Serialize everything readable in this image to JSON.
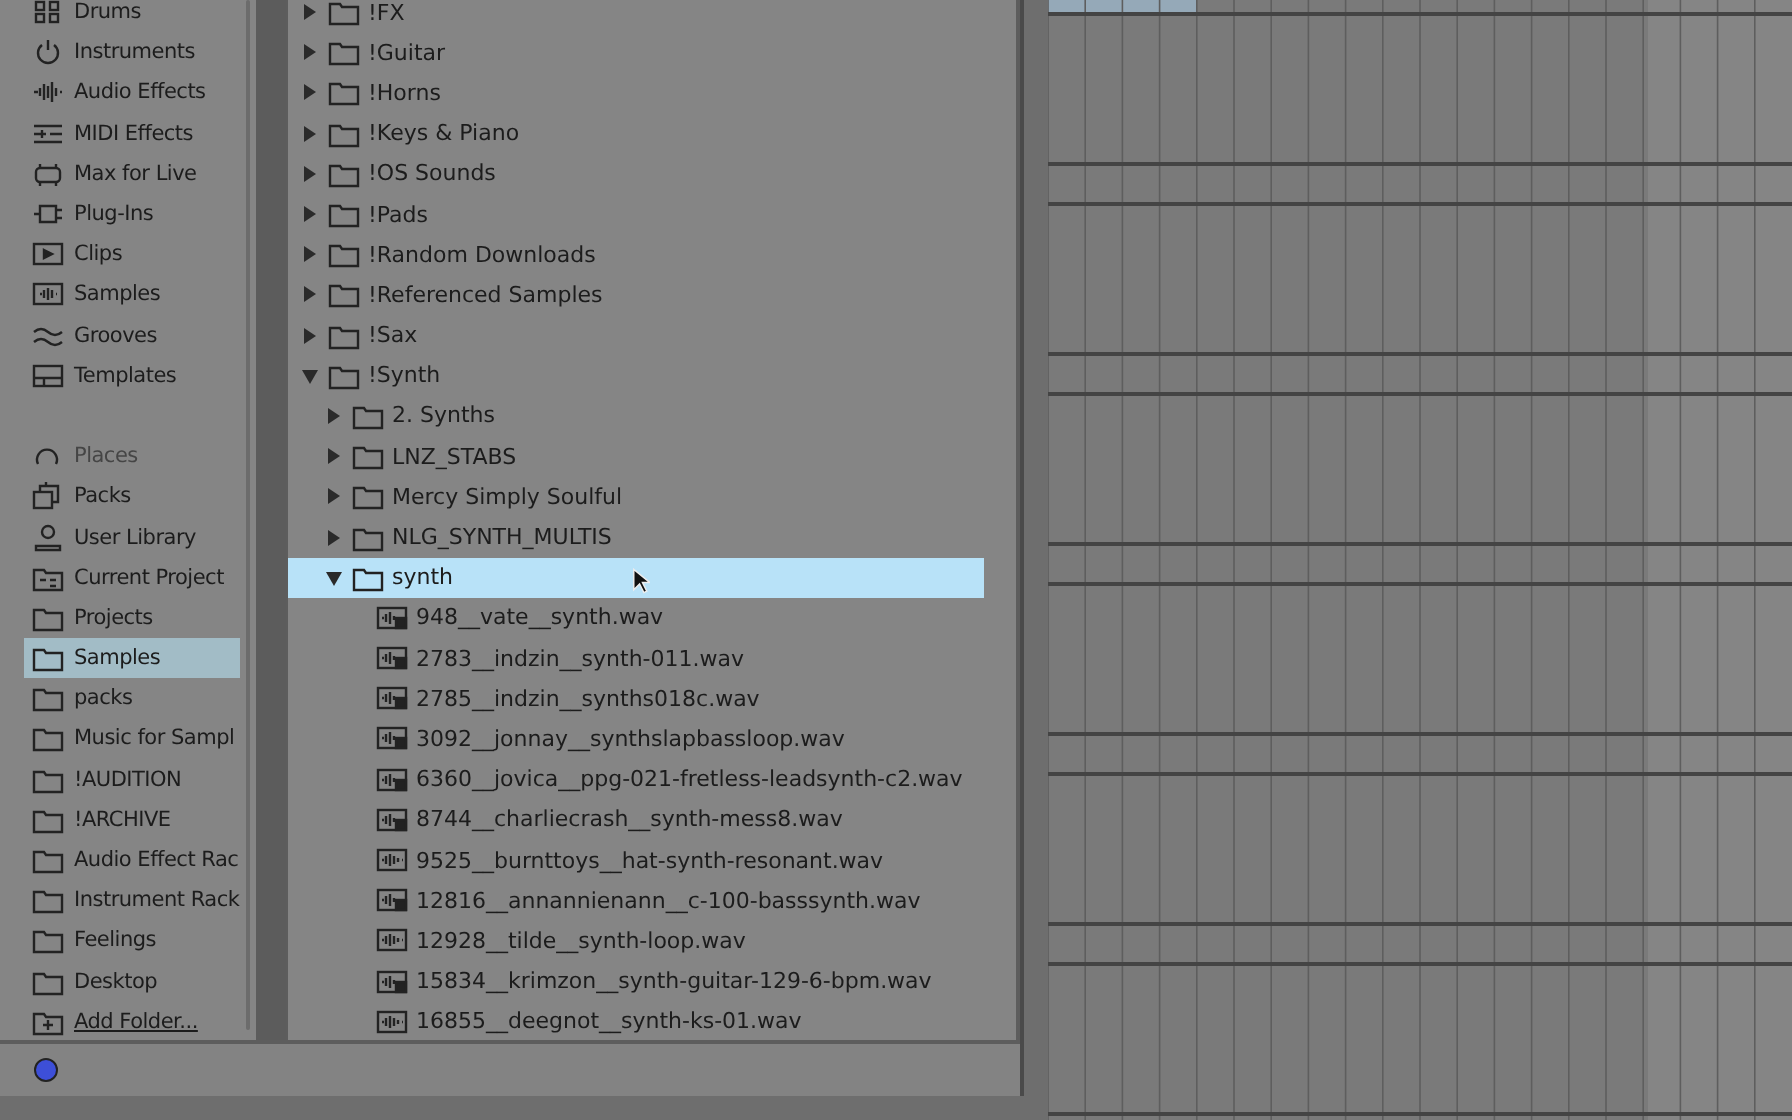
{
  "sidebar": {
    "categories": [
      {
        "label": "Drums"
      },
      {
        "label": "Instruments"
      },
      {
        "label": "Audio Effects"
      },
      {
        "label": "MIDI Effects"
      },
      {
        "label": "Max for Live"
      },
      {
        "label": "Plug-Ins"
      },
      {
        "label": "Clips"
      },
      {
        "label": "Samples"
      },
      {
        "label": "Grooves"
      },
      {
        "label": "Templates"
      }
    ],
    "places_heading": "Places",
    "places": [
      {
        "label": "Packs",
        "kind": "packs",
        "selected": false
      },
      {
        "label": "User Library",
        "kind": "user",
        "selected": false
      },
      {
        "label": "Current Project",
        "kind": "project",
        "selected": false
      },
      {
        "label": "Projects",
        "kind": "folder",
        "selected": false
      },
      {
        "label": "Samples",
        "kind": "folder",
        "selected": true
      },
      {
        "label": "packs",
        "kind": "folder",
        "selected": false
      },
      {
        "label": "Music for Sampl",
        "kind": "folder",
        "selected": false
      },
      {
        "label": "!AUDITION",
        "kind": "folder",
        "selected": false
      },
      {
        "label": "!ARCHIVE",
        "kind": "folder",
        "selected": false
      },
      {
        "label": "Audio Effect Rac",
        "kind": "folder",
        "selected": false
      },
      {
        "label": "Instrument Rack",
        "kind": "folder",
        "selected": false
      },
      {
        "label": "Feelings",
        "kind": "folder",
        "selected": false
      },
      {
        "label": "Desktop",
        "kind": "folder",
        "selected": false
      }
    ],
    "add_folder": "Add Folder..."
  },
  "tree": [
    {
      "kind": "folder",
      "name": "!FX",
      "expanded": false,
      "selected": false
    },
    {
      "kind": "folder",
      "name": "!Guitar",
      "expanded": false,
      "selected": false
    },
    {
      "kind": "folder",
      "name": "!Horns",
      "expanded": false,
      "selected": false
    },
    {
      "kind": "folder",
      "name": "!Keys & Piano",
      "expanded": false,
      "selected": false
    },
    {
      "kind": "folder",
      "name": "!OS Sounds",
      "expanded": false,
      "selected": false
    },
    {
      "kind": "folder",
      "name": "!Pads",
      "expanded": false,
      "selected": false
    },
    {
      "kind": "folder",
      "name": "!Random Downloads",
      "expanded": false,
      "selected": false
    },
    {
      "kind": "folder",
      "name": "!Referenced Samples",
      "expanded": false,
      "selected": false
    },
    {
      "kind": "folder",
      "name": "!Sax",
      "expanded": false,
      "selected": false
    },
    {
      "kind": "folder",
      "name": "!Synth",
      "expanded": true,
      "selected": false,
      "children": [
        {
          "kind": "folder",
          "name": "2. Synths",
          "expanded": false,
          "selected": false
        },
        {
          "kind": "folder",
          "name": "LNZ_STABS",
          "expanded": false,
          "selected": false
        },
        {
          "kind": "folder",
          "name": "Mercy Simply Soulful",
          "expanded": false,
          "selected": false
        },
        {
          "kind": "folder",
          "name": "NLG_SYNTH_MULTIS",
          "expanded": false,
          "selected": false
        },
        {
          "kind": "folder",
          "name": "synth",
          "expanded": true,
          "selected": true,
          "children": [
            {
              "kind": "analyzed",
              "name": "948__vate__synth.wav",
              "selected": false
            },
            {
              "kind": "analyzed",
              "name": "2783__indzin__synth-011.wav",
              "selected": false
            },
            {
              "kind": "analyzed",
              "name": "2785__indzin__synths018c.wav",
              "selected": false
            },
            {
              "kind": "analyzed",
              "name": "3092__jonnay__synthslapbassloop.wav",
              "selected": false
            },
            {
              "kind": "analyzed",
              "name": "6360__jovica__ppg-021-fretless-leadsynth-c2.wav",
              "selected": false
            },
            {
              "kind": "analyzed",
              "name": "8744__charliecrash__synth-mess8.wav",
              "selected": false
            },
            {
              "kind": "plain",
              "name": "9525__burnttoys__hat-synth-resonant.wav",
              "selected": false
            },
            {
              "kind": "analyzed",
              "name": "12816__annannienann__c-100-basssynth.wav",
              "selected": false
            },
            {
              "kind": "plain",
              "name": "12928__tilde__synth-loop.wav",
              "selected": false
            },
            {
              "kind": "analyzed",
              "name": "15834__krimzon__synth-guitar-129-6-bpm.wav",
              "selected": false
            },
            {
              "kind": "plain",
              "name": "16855__deegnot__synth-ks-01.wav",
              "selected": false
            }
          ]
        }
      ]
    }
  ]
}
